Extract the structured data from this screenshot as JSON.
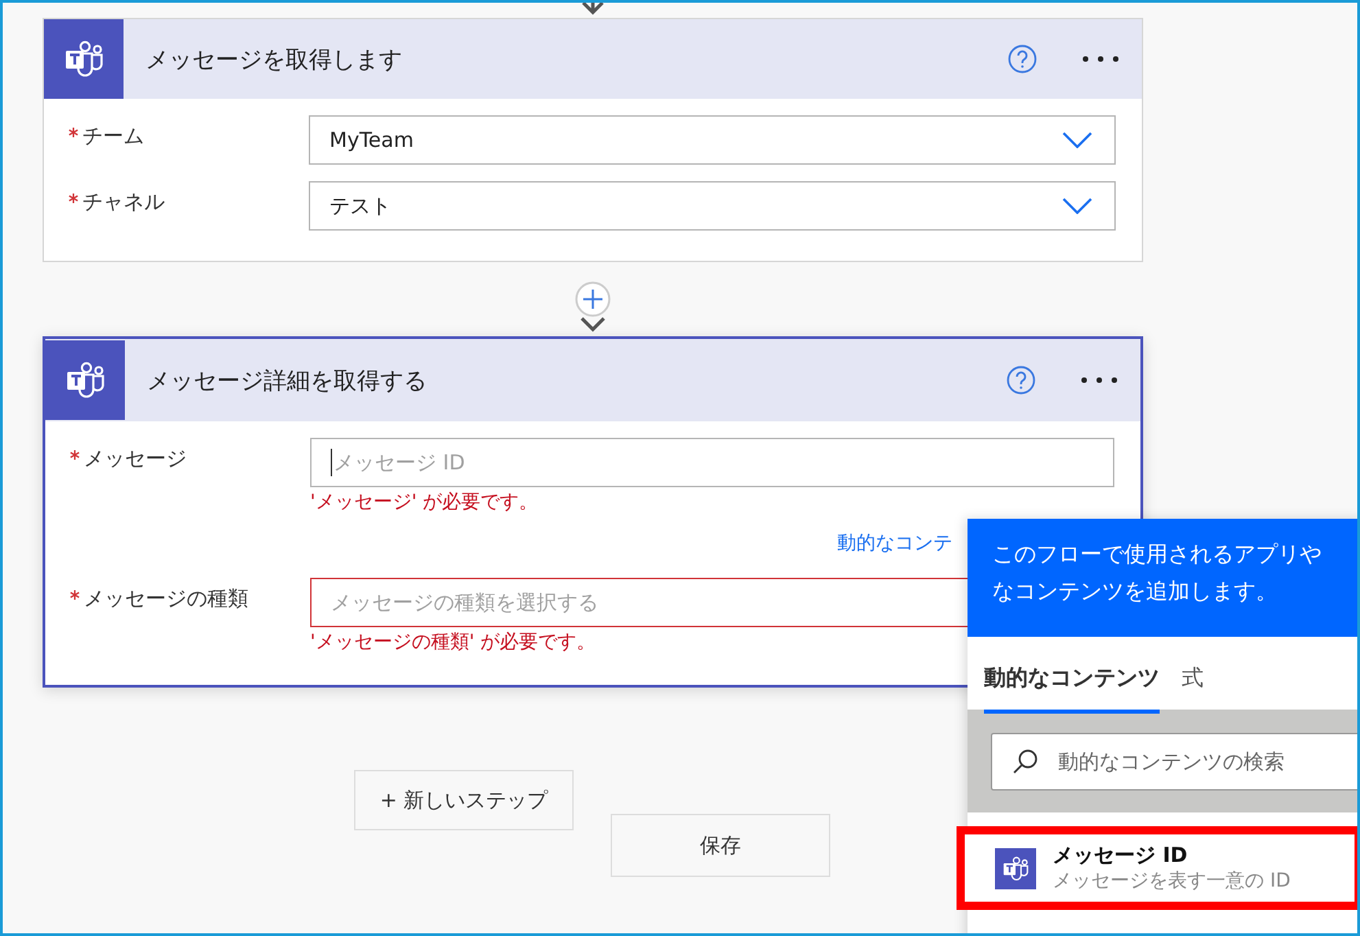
{
  "steps": [
    {
      "title": "メッセージを取得します",
      "active": false,
      "fields": [
        {
          "label": "チーム",
          "required": true,
          "kind": "dropdown",
          "value": "MyTeam"
        },
        {
          "label": "チャネル",
          "required": true,
          "kind": "dropdown",
          "value": "テスト"
        }
      ]
    },
    {
      "title": "メッセージ詳細を取得する",
      "active": true,
      "fields": [
        {
          "label": "メッセージ",
          "required": true,
          "kind": "text",
          "placeholder": "メッセージ ID",
          "focused": true,
          "invalid": false,
          "error": "'メッセージ' が必要です。",
          "link": "動的なコンテ"
        },
        {
          "label": "メッセージの種類",
          "required": true,
          "kind": "text",
          "placeholder": "メッセージの種類を選択する",
          "focused": false,
          "invalid": true,
          "error": "'メッセージの種類' が必要です。"
        }
      ]
    }
  ],
  "buttons": [
    "+ 新しいステップ",
    "保存"
  ],
  "dynamic_panel": {
    "description": [
      "このフローで使用されるアプリや",
      "なコンテンツを追加します。"
    ],
    "tabs": [
      {
        "label": "動的なコンテンツ",
        "selected": true
      },
      {
        "label": "式",
        "selected": false
      }
    ],
    "search": {
      "placeholder": "動的なコンテンツの検索"
    },
    "items": [
      {
        "title": "メッセージ ID",
        "subtitle": "メッセージを表す一意の ID",
        "highlighted": true
      }
    ]
  }
}
